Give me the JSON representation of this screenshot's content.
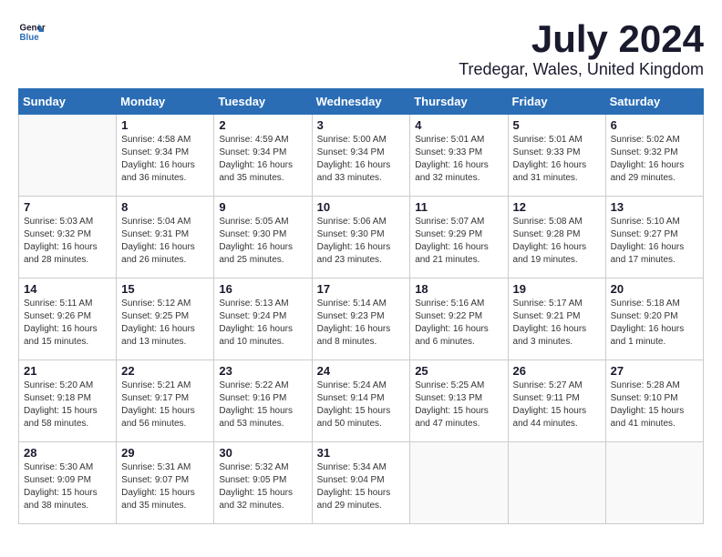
{
  "logo": {
    "line1": "General",
    "line2": "Blue"
  },
  "title": {
    "month_year": "July 2024",
    "location": "Tredegar, Wales, United Kingdom"
  },
  "weekdays": [
    "Sunday",
    "Monday",
    "Tuesday",
    "Wednesday",
    "Thursday",
    "Friday",
    "Saturday"
  ],
  "weeks": [
    [
      {
        "day": "",
        "info": ""
      },
      {
        "day": "1",
        "info": "Sunrise: 4:58 AM\nSunset: 9:34 PM\nDaylight: 16 hours\nand 36 minutes."
      },
      {
        "day": "2",
        "info": "Sunrise: 4:59 AM\nSunset: 9:34 PM\nDaylight: 16 hours\nand 35 minutes."
      },
      {
        "day": "3",
        "info": "Sunrise: 5:00 AM\nSunset: 9:34 PM\nDaylight: 16 hours\nand 33 minutes."
      },
      {
        "day": "4",
        "info": "Sunrise: 5:01 AM\nSunset: 9:33 PM\nDaylight: 16 hours\nand 32 minutes."
      },
      {
        "day": "5",
        "info": "Sunrise: 5:01 AM\nSunset: 9:33 PM\nDaylight: 16 hours\nand 31 minutes."
      },
      {
        "day": "6",
        "info": "Sunrise: 5:02 AM\nSunset: 9:32 PM\nDaylight: 16 hours\nand 29 minutes."
      }
    ],
    [
      {
        "day": "7",
        "info": "Sunrise: 5:03 AM\nSunset: 9:32 PM\nDaylight: 16 hours\nand 28 minutes."
      },
      {
        "day": "8",
        "info": "Sunrise: 5:04 AM\nSunset: 9:31 PM\nDaylight: 16 hours\nand 26 minutes."
      },
      {
        "day": "9",
        "info": "Sunrise: 5:05 AM\nSunset: 9:30 PM\nDaylight: 16 hours\nand 25 minutes."
      },
      {
        "day": "10",
        "info": "Sunrise: 5:06 AM\nSunset: 9:30 PM\nDaylight: 16 hours\nand 23 minutes."
      },
      {
        "day": "11",
        "info": "Sunrise: 5:07 AM\nSunset: 9:29 PM\nDaylight: 16 hours\nand 21 minutes."
      },
      {
        "day": "12",
        "info": "Sunrise: 5:08 AM\nSunset: 9:28 PM\nDaylight: 16 hours\nand 19 minutes."
      },
      {
        "day": "13",
        "info": "Sunrise: 5:10 AM\nSunset: 9:27 PM\nDaylight: 16 hours\nand 17 minutes."
      }
    ],
    [
      {
        "day": "14",
        "info": "Sunrise: 5:11 AM\nSunset: 9:26 PM\nDaylight: 16 hours\nand 15 minutes."
      },
      {
        "day": "15",
        "info": "Sunrise: 5:12 AM\nSunset: 9:25 PM\nDaylight: 16 hours\nand 13 minutes."
      },
      {
        "day": "16",
        "info": "Sunrise: 5:13 AM\nSunset: 9:24 PM\nDaylight: 16 hours\nand 10 minutes."
      },
      {
        "day": "17",
        "info": "Sunrise: 5:14 AM\nSunset: 9:23 PM\nDaylight: 16 hours\nand 8 minutes."
      },
      {
        "day": "18",
        "info": "Sunrise: 5:16 AM\nSunset: 9:22 PM\nDaylight: 16 hours\nand 6 minutes."
      },
      {
        "day": "19",
        "info": "Sunrise: 5:17 AM\nSunset: 9:21 PM\nDaylight: 16 hours\nand 3 minutes."
      },
      {
        "day": "20",
        "info": "Sunrise: 5:18 AM\nSunset: 9:20 PM\nDaylight: 16 hours\nand 1 minute."
      }
    ],
    [
      {
        "day": "21",
        "info": "Sunrise: 5:20 AM\nSunset: 9:18 PM\nDaylight: 15 hours\nand 58 minutes."
      },
      {
        "day": "22",
        "info": "Sunrise: 5:21 AM\nSunset: 9:17 PM\nDaylight: 15 hours\nand 56 minutes."
      },
      {
        "day": "23",
        "info": "Sunrise: 5:22 AM\nSunset: 9:16 PM\nDaylight: 15 hours\nand 53 minutes."
      },
      {
        "day": "24",
        "info": "Sunrise: 5:24 AM\nSunset: 9:14 PM\nDaylight: 15 hours\nand 50 minutes."
      },
      {
        "day": "25",
        "info": "Sunrise: 5:25 AM\nSunset: 9:13 PM\nDaylight: 15 hours\nand 47 minutes."
      },
      {
        "day": "26",
        "info": "Sunrise: 5:27 AM\nSunset: 9:11 PM\nDaylight: 15 hours\nand 44 minutes."
      },
      {
        "day": "27",
        "info": "Sunrise: 5:28 AM\nSunset: 9:10 PM\nDaylight: 15 hours\nand 41 minutes."
      }
    ],
    [
      {
        "day": "28",
        "info": "Sunrise: 5:30 AM\nSunset: 9:09 PM\nDaylight: 15 hours\nand 38 minutes."
      },
      {
        "day": "29",
        "info": "Sunrise: 5:31 AM\nSunset: 9:07 PM\nDaylight: 15 hours\nand 35 minutes."
      },
      {
        "day": "30",
        "info": "Sunrise: 5:32 AM\nSunset: 9:05 PM\nDaylight: 15 hours\nand 32 minutes."
      },
      {
        "day": "31",
        "info": "Sunrise: 5:34 AM\nSunset: 9:04 PM\nDaylight: 15 hours\nand 29 minutes."
      },
      {
        "day": "",
        "info": ""
      },
      {
        "day": "",
        "info": ""
      },
      {
        "day": "",
        "info": ""
      }
    ]
  ]
}
